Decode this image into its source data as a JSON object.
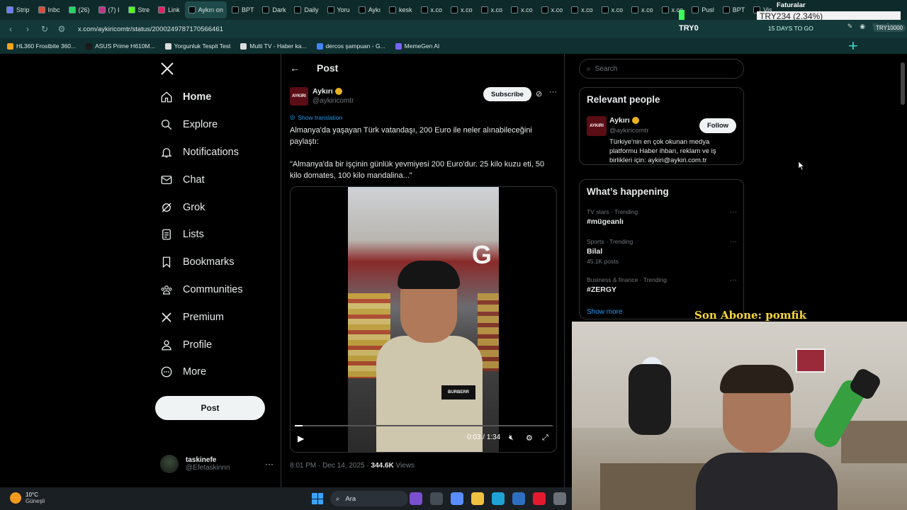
{
  "browser": {
    "tabs": [
      {
        "label": "Strip",
        "color": "#6f7cff"
      },
      {
        "label": "Inbc",
        "color": "#e04a3a"
      },
      {
        "label": "(26)",
        "color": "#25d366"
      },
      {
        "label": "(7) I",
        "color": "#c13584"
      },
      {
        "label": "Stre",
        "color": "#53fc18"
      },
      {
        "label": "Link",
        "color": "#e91e63"
      },
      {
        "label": "Aykırı on",
        "color": "#000000",
        "active": true
      },
      {
        "label": "BPT",
        "color": "#000000"
      },
      {
        "label": "Dark",
        "color": "#000000"
      },
      {
        "label": "Daily",
        "color": "#000000"
      },
      {
        "label": "Yoru",
        "color": "#000000"
      },
      {
        "label": "Aykı",
        "color": "#000000"
      },
      {
        "label": "kesk",
        "color": "#000000"
      },
      {
        "label": "x.co",
        "color": "#000000"
      },
      {
        "label": "x.co",
        "color": "#000000"
      },
      {
        "label": "x.co",
        "color": "#000000"
      },
      {
        "label": "x.co",
        "color": "#000000"
      },
      {
        "label": "x.co",
        "color": "#000000"
      },
      {
        "label": "x.co",
        "color": "#000000"
      },
      {
        "label": "x.co",
        "color": "#000000"
      },
      {
        "label": "x.co",
        "color": "#000000"
      },
      {
        "label": "x.co",
        "color": "#000000"
      },
      {
        "label": "Pusl",
        "color": "#000000"
      },
      {
        "label": "BPT",
        "color": "#000000"
      },
      {
        "label": "Vis",
        "color": "#000000"
      }
    ],
    "url": "x.com/aykiricomtr/status/2000249787170566461",
    "bookmarks": [
      {
        "label": "HL360 Frostbite 360...",
        "color": "#f7a31c"
      },
      {
        "label": "ASUS Prime H610M...",
        "color": "#1a1a1a"
      },
      {
        "label": "Yorgunluk Tespit Test",
        "color": "#dddddd"
      },
      {
        "label": "Multi TV - Haber ka...",
        "color": "#dddddd"
      },
      {
        "label": "dercos şampuan - G...",
        "color": "#4285f4"
      },
      {
        "label": "MemeGen AI",
        "color": "#7b61ff"
      }
    ]
  },
  "stream_overlay": {
    "ticker_label": "Faturalar",
    "ticker": "TRY234 (2.34%)",
    "left_amount": "TRY0",
    "days": "15 DAYS TO GO",
    "right_amount": "TRY10000",
    "son_abone": "Son Abone: pomfik"
  },
  "sidebar": {
    "items": [
      {
        "label": "Home",
        "icon": "home-icon"
      },
      {
        "label": "Explore",
        "icon": "search-icon"
      },
      {
        "label": "Notifications",
        "icon": "bell-icon"
      },
      {
        "label": "Chat",
        "icon": "mail-icon"
      },
      {
        "label": "Grok",
        "icon": "grok-icon"
      },
      {
        "label": "Lists",
        "icon": "list-icon"
      },
      {
        "label": "Bookmarks",
        "icon": "bookmark-icon"
      },
      {
        "label": "Communities",
        "icon": "communities-icon"
      },
      {
        "label": "Premium",
        "icon": "x-logo-icon"
      },
      {
        "label": "Profile",
        "icon": "person-icon"
      },
      {
        "label": "More",
        "icon": "more-circle-icon"
      }
    ],
    "post_button": "Post",
    "account": {
      "name": "taskinefe",
      "handle": "@Efetaskinnn"
    }
  },
  "post": {
    "header_title": "Post",
    "author": {
      "name": "Aykırı",
      "handle": "@aykiricomtr",
      "avatar_text": "AYKIRI"
    },
    "subscribe": "Subscribe",
    "show_translation": "Show translation",
    "paragraphs": [
      "Almanya'da yaşayan Türk vatandaşı, 200 Euro ile neler alınabileceğini paylaştı:",
      "\"Almanya'da bir işçinin günlük yevmiyesi 200 Euro'dur. 25 kilo kuzu eti, 50 kilo domates, 100 kilo mandalina...\""
    ],
    "video": {
      "current": "0:03",
      "duration": "1:34",
      "progress": 0.03,
      "sign_text": "G",
      "badge_text": "BURBERR"
    },
    "timestamp": "8:01 PM · Dec 14, 2025 · ",
    "views_count": "344.6K",
    "views_label": " Views"
  },
  "right": {
    "search_placeholder": "Search",
    "relevant_title": "Relevant people",
    "relevant": {
      "name": "Aykırı",
      "handle": "@aykiricomtr",
      "follow": "Follow",
      "bio": "Türkiye'nin en çok okunan medya platformu Haber ihbarı, reklam ve iş birlikleri için: aykiri@aykiri.com.tr"
    },
    "happening_title": "What’s happening",
    "trends": [
      {
        "category": "TV stars · Trending",
        "name": "#mügeanlı",
        "posts": ""
      },
      {
        "category": "Sports · Trending",
        "name": "Bilal",
        "posts": "45.1K posts"
      },
      {
        "category": "Business & finance · Trending",
        "name": "#ZERGY",
        "posts": ""
      }
    ],
    "show_more": "Show more"
  },
  "taskbar": {
    "temp": "10°C",
    "weather": "Güneşli",
    "search": "Ara",
    "apps": [
      {
        "name": "game-app-icon",
        "color": "#7a4fd0"
      },
      {
        "name": "files-app-icon",
        "color": "#444c55"
      },
      {
        "name": "copilot-app-icon",
        "color": "#5a8dff"
      },
      {
        "name": "explorer-app-icon",
        "color": "#f0c040"
      },
      {
        "name": "edge-app-icon",
        "color": "#1fa3d6"
      },
      {
        "name": "store-app-icon",
        "color": "#2f6fc0"
      },
      {
        "name": "opera-app-icon",
        "color": "#e3192f"
      },
      {
        "name": "settings-app-icon",
        "color": "#6b7078"
      }
    ]
  },
  "colors": {
    "accent": "#1d9bf0",
    "background": "#000000",
    "border": "#2f3336",
    "muted": "#71767b"
  }
}
